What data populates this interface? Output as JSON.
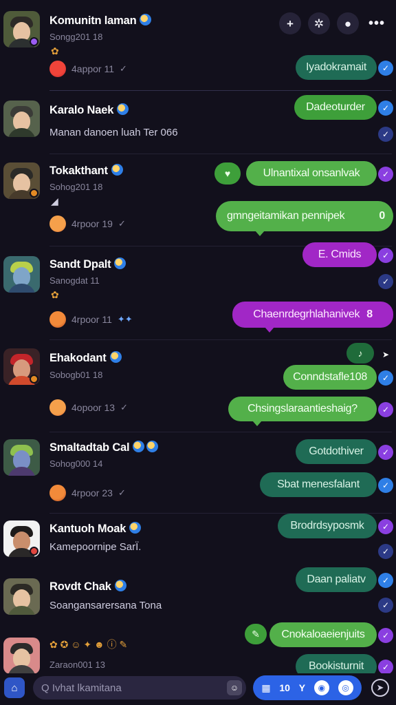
{
  "toolbar": {
    "compose_icon": "+",
    "sparkle_icon": "✲",
    "profile_icon": "●",
    "more_icon": "•••"
  },
  "conversations": [
    {
      "name": "Komunitn laman",
      "sub": "Songg201 18",
      "time": "4appor 11",
      "bubbles": [
        {
          "text": "Iyadokramait",
          "style": "teal"
        }
      ]
    },
    {
      "name": "Karalo Naek",
      "preview": "Manan danoen luah Ter 066",
      "bubbles": [
        {
          "text": "Dadeoturder",
          "style": "green"
        }
      ]
    },
    {
      "name": "Tokakthant",
      "sub": "Sohog201 18",
      "time": "4rpoor 19",
      "bubbles": [
        {
          "text": "Ulnantixal onsanlvak",
          "style": "lgreen"
        },
        {
          "text": "gmngeitamikan pennipek",
          "style": "lgreen",
          "tail_badge": "0"
        }
      ]
    },
    {
      "name": "Sandt Dpalt",
      "sub": "Sanogdat 11",
      "time": "4rpoor 11",
      "bubbles": [
        {
          "text": "E. Cmids",
          "style": "purple"
        },
        {
          "text": "Chaenrdegrhlahanivek",
          "style": "purple",
          "tail_badge": "8"
        }
      ]
    },
    {
      "name": "Ehakodant",
      "sub": "Sobogb01 18",
      "time": "4opoor 13",
      "bubbles": [
        {
          "text": "Conndstafle108",
          "style": "lgreen"
        },
        {
          "text": "Chsingslaraantieshaig?",
          "style": "lgreen"
        }
      ]
    },
    {
      "name": "Smaltadtab Cal",
      "sub": "Sohog000 14",
      "time": "4rpoor 23",
      "bubbles": [
        {
          "text": "Gotdothiver",
          "style": "teal"
        },
        {
          "text": "Sbat menesfalant",
          "style": "teal"
        }
      ]
    },
    {
      "name": "Kantuoh Moak",
      "preview": "Kamepoornipe SarÏ.",
      "bubbles": [
        {
          "text": "Brodrdsyposmk",
          "style": "teal"
        }
      ]
    },
    {
      "name": "Rovdt Chak",
      "preview": "Soangansarersana Tona",
      "bubbles": [
        {
          "text": "Daan paliatv",
          "style": "teal"
        }
      ]
    },
    {
      "name": "",
      "sub": "Zaraon001 13",
      "bubbles": [
        {
          "text": "Cnokaloaeienjuits",
          "style": "lgreen"
        },
        {
          "text": "Bookisturnit",
          "style": "teal"
        }
      ]
    }
  ],
  "composer": {
    "placeholder": "Q Ivhat lkamitana",
    "tools": [
      "10",
      "Y"
    ]
  },
  "colors": {
    "background": "#12101c",
    "teal": "#1f6b55",
    "green": "#3e9f3a",
    "purple": "#a127c6",
    "blue": "#2f7fe6"
  }
}
